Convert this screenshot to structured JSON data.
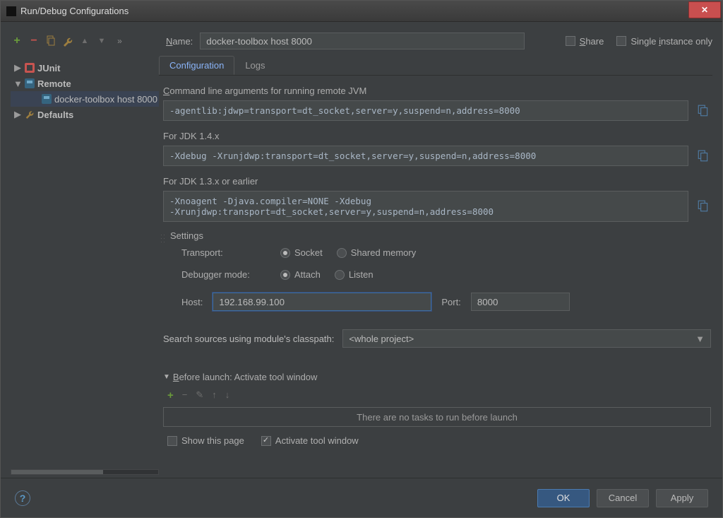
{
  "window": {
    "title": "Run/Debug Configurations",
    "close_glyph": "✕"
  },
  "toolbar": {
    "plus": "+",
    "minus": "−",
    "up": "▲",
    "down": "▼",
    "chevrons": "»"
  },
  "name": {
    "label": "Name:",
    "value": "docker-toolbox host 8000"
  },
  "topchecks": {
    "share": "Share",
    "single": "Single instance only"
  },
  "tree": {
    "items": [
      {
        "label": "JUnit",
        "expanded": false,
        "icon": "junit"
      },
      {
        "label": "Remote",
        "expanded": true,
        "icon": "remote",
        "children": [
          {
            "label": "docker-toolbox host 8000",
            "icon": "remote"
          }
        ]
      },
      {
        "label": "Defaults",
        "expanded": false,
        "icon": "defaults"
      }
    ]
  },
  "tabs": {
    "active": "Configuration",
    "items": [
      "Configuration",
      "Logs"
    ]
  },
  "cli": {
    "label": "Command line arguments for running remote JVM",
    "value": "-agentlib:jdwp=transport=dt_socket,server=y,suspend=n,address=8000"
  },
  "jdk14": {
    "label": "For JDK 1.4.x",
    "value": "-Xdebug -Xrunjdwp:transport=dt_socket,server=y,suspend=n,address=8000"
  },
  "jdk13": {
    "label": "For JDK 1.3.x or earlier",
    "value": "-Xnoagent -Djava.compiler=NONE -Xdebug\n-Xrunjdwp:transport=dt_socket,server=y,suspend=n,address=8000"
  },
  "settings": {
    "title": "Settings",
    "transport_label": "Transport:",
    "transport_socket": "Socket",
    "transport_shared": "Shared memory",
    "mode_label": "Debugger mode:",
    "mode_attach": "Attach",
    "mode_listen": "Listen",
    "host_label": "Host:",
    "host_value": "192.168.99.100",
    "port_label": "Port:",
    "port_value": "8000"
  },
  "search": {
    "label": "Search sources using module's classpath:",
    "value": "<whole project>"
  },
  "before": {
    "title": "Before launch: Activate tool window",
    "empty": "There are no tasks to run before launch",
    "show_page": "Show this page",
    "activate": "Activate tool window"
  },
  "footer": {
    "help": "?",
    "ok": "OK",
    "cancel": "Cancel",
    "apply": "Apply"
  }
}
